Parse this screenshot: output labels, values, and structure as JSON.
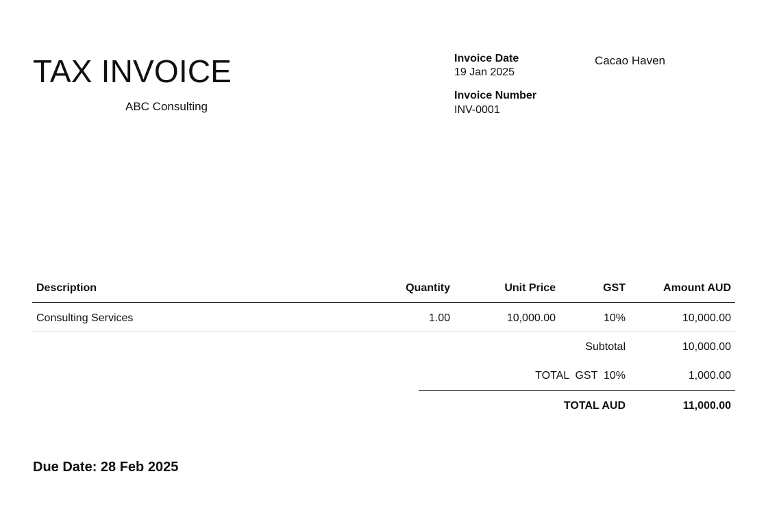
{
  "header": {
    "title": "TAX INVOICE",
    "company": "ABC Consulting"
  },
  "meta": {
    "invoice_date_label": "Invoice Date",
    "invoice_date": "19 Jan 2025",
    "invoice_number_label": "Invoice Number",
    "invoice_number": "INV-0001",
    "client": "Cacao Haven"
  },
  "table": {
    "columns": [
      "Description",
      "Quantity",
      "Unit Price",
      "GST",
      "Amount AUD"
    ],
    "rows": [
      [
        "Consulting Services",
        "1.00",
        "10,000.00",
        "10%",
        "10,000.00"
      ]
    ]
  },
  "totals": {
    "subtotal_label": "Subtotal",
    "subtotal_value": "10,000.00",
    "gst_label": "TOTAL  GST  10%",
    "gst_value": "1,000.00",
    "total_label": "TOTAL AUD",
    "total_value": "11,000.00"
  },
  "footer": {
    "due_date": "Due Date: 28 Feb 2025"
  }
}
